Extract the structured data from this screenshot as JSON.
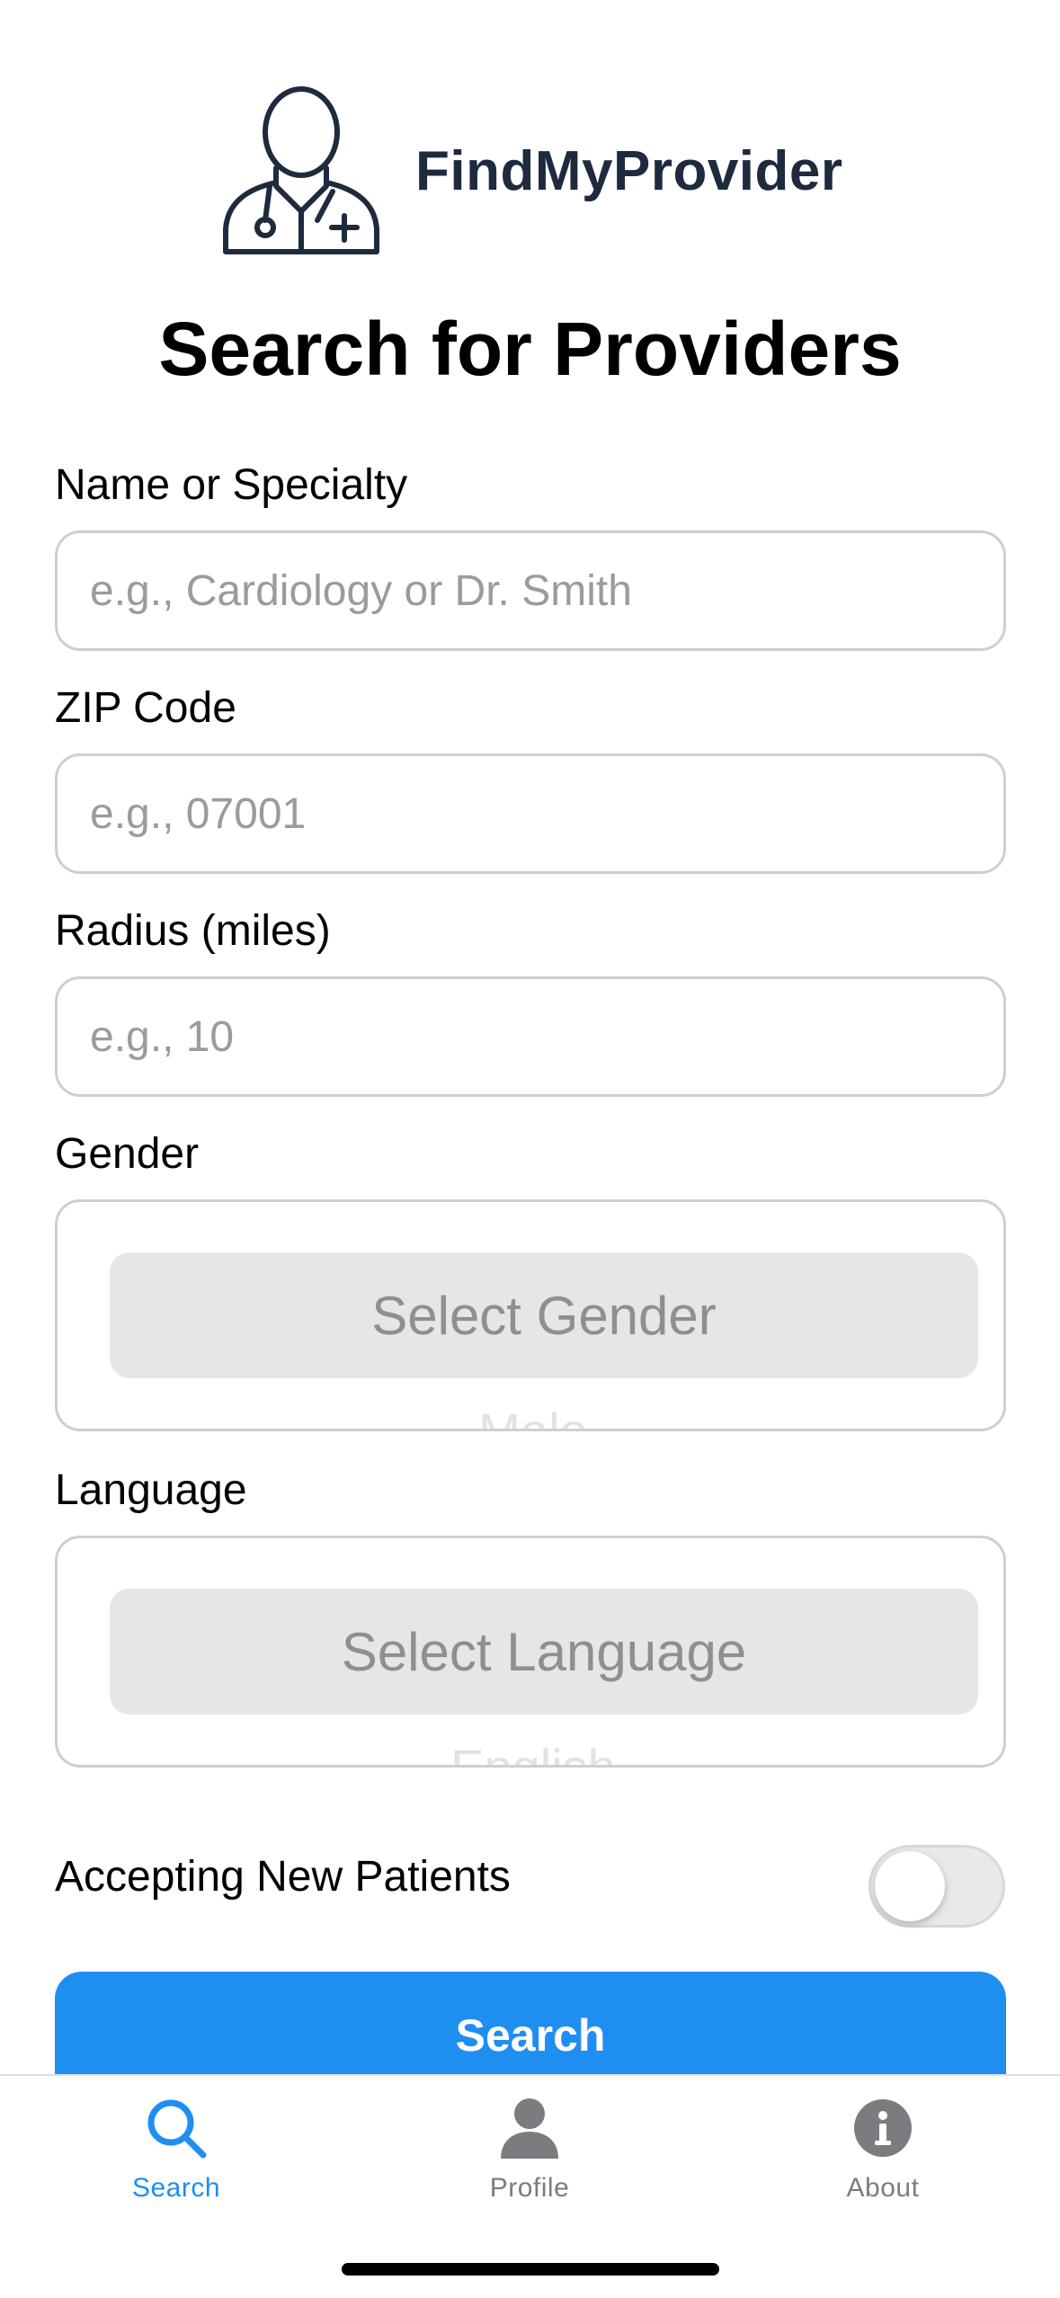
{
  "brand": {
    "name": "FindMyProvider",
    "logo_icon": "doctor-icon"
  },
  "page": {
    "title": "Search for Providers"
  },
  "form": {
    "name_specialty": {
      "label": "Name or Specialty",
      "placeholder": "e.g., Cardiology or Dr. Smith",
      "value": ""
    },
    "zip": {
      "label": "ZIP Code",
      "placeholder": "e.g., 07001",
      "value": ""
    },
    "radius": {
      "label": "Radius (miles)",
      "placeholder": "e.g., 10",
      "value": ""
    },
    "gender": {
      "label": "Gender",
      "selected": "Select Gender",
      "next_option": "Male"
    },
    "language": {
      "label": "Language",
      "selected": "Select Language",
      "next_option": "English"
    },
    "accepting_new": {
      "label": "Accepting New Patients",
      "on": false
    },
    "search_button": "Search"
  },
  "tabs": [
    {
      "label": "Search",
      "icon": "search-icon",
      "active": true
    },
    {
      "label": "Profile",
      "icon": "person-icon",
      "active": false
    },
    {
      "label": "About",
      "icon": "info-icon",
      "active": false
    }
  ],
  "colors": {
    "accent": "#1f8ef1",
    "brand_text": "#1e2a3e",
    "inactive": "#7c7c80"
  }
}
